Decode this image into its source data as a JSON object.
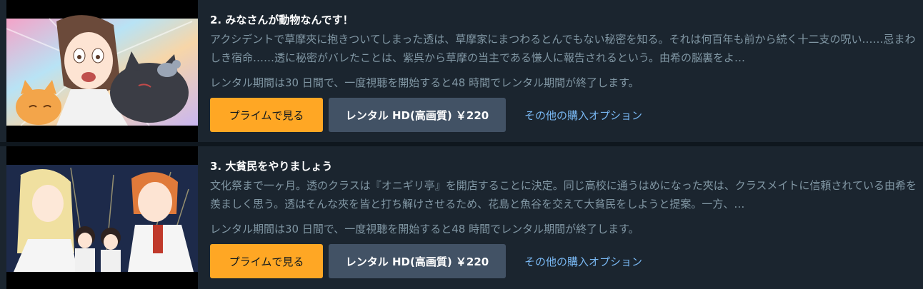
{
  "episodes": [
    {
      "title": "2. みなさんが動物なんです！",
      "synopsis": "アクシデントで草摩夾に抱きついてしまった透は、草摩家にまつわるとんでもない秘密を知る。それは何百年も前から続く十二支の呪い……忌まわしき宿命……透に秘密がバレたことは、紫呉から草摩の当主である慊人に報告されるという。由希の脳裏をよ…",
      "rental_note": "レンタル期間は30 日間で、一度視聴を開始すると48 時間でレンタル期間が終了します。",
      "prime_button": "プライムで見る",
      "rent_button": "レンタル HD(高画質) ￥220",
      "more_options": "その他の購入オプション"
    },
    {
      "title": "3. 大貧民をやりましょう",
      "synopsis": "文化祭まで一ヶ月。透のクラスは『オニギリ亭』を開店することに決定。同じ高校に通うはめになった夾は、クラスメイトに信頼されている由希を羨ましく思う。透はそんな夾を皆と打ち解けさせるため、花島と魚谷を交えて大貧民をしようと提案。一方、…",
      "rental_note": "レンタル期間は30 日間で、一度視聴を開始すると48 時間でレンタル期間が終了します。",
      "prime_button": "プライムで見る",
      "rent_button": "レンタル HD(高画質) ￥220",
      "more_options": "その他の購入オプション"
    }
  ],
  "colors": {
    "background": "#0f171e",
    "card": "#1b252f",
    "prime_button": "#ffa724",
    "rent_button": "#425265",
    "link": "#79b8f3",
    "muted_text": "#8197a4"
  }
}
